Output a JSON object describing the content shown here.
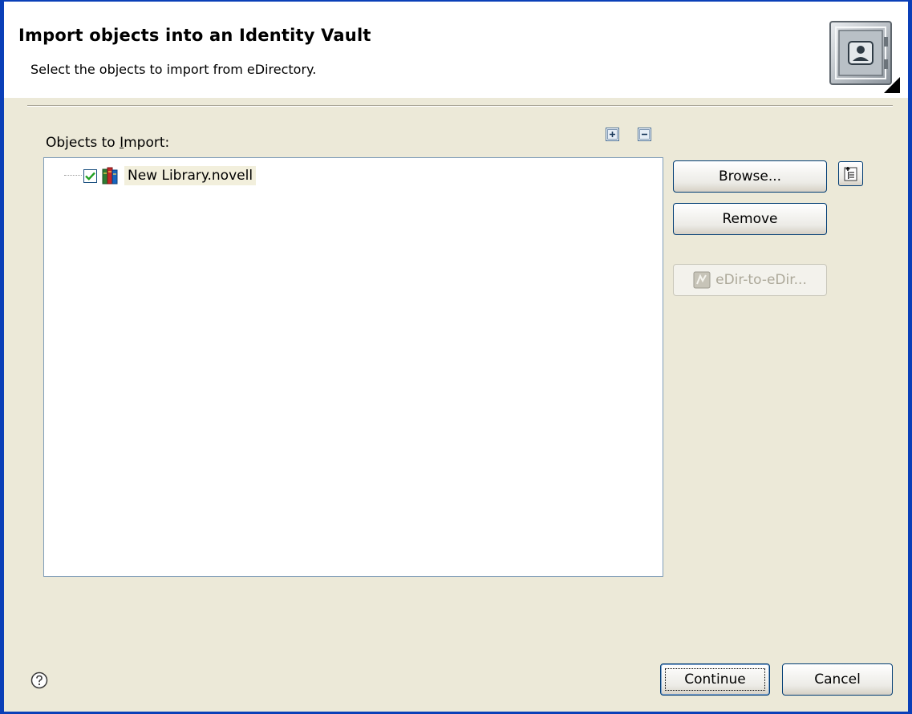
{
  "banner": {
    "title": "Import objects into an Identity Vault",
    "subtitle": "Select the objects to import from eDirectory.",
    "icon": "vault-icon"
  },
  "objects": {
    "label_prefix": "Objects to ",
    "label_mnemonic": "I",
    "label_suffix": "mport:",
    "expand_all_icon": "expand-all-icon",
    "collapse_all_icon": "collapse-all-icon",
    "tree_items": [
      {
        "label": "New Library.novell",
        "checked": true,
        "icon": "library-books-icon"
      }
    ]
  },
  "buttons": {
    "browse": "Browse...",
    "remove": "Remove",
    "edir_to_edir": "eDir-to-eDir...",
    "continue": "Continue",
    "cancel": "Cancel"
  },
  "colors": {
    "window_border": "#0A3FB8",
    "dialog_background": "#ECE9D8",
    "checkbox_check": "#21A121"
  }
}
